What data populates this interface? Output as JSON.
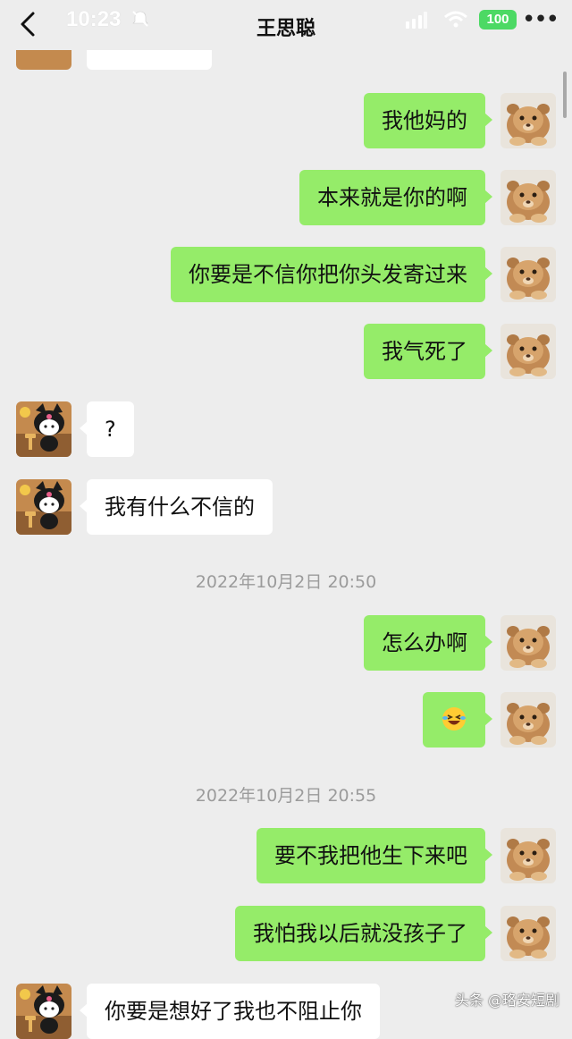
{
  "status": {
    "time": "10:23",
    "battery": "100"
  },
  "header": {
    "title": "王思聪"
  },
  "messages": [
    {
      "side": "me",
      "text": "我他妈的"
    },
    {
      "side": "me",
      "text": "本来就是你的啊"
    },
    {
      "side": "me",
      "text": "你要是不信你把你头发寄过来"
    },
    {
      "side": "me",
      "text": "我气死了"
    },
    {
      "side": "them",
      "text": "?"
    },
    {
      "side": "them",
      "text": "我有什么不信的"
    },
    {
      "timestamp": "2022年10月2日 20:50"
    },
    {
      "side": "me",
      "text": "怎么办啊"
    },
    {
      "side": "me",
      "emoji": "laughing-tears-emoji"
    },
    {
      "timestamp": "2022年10月2日 20:55"
    },
    {
      "side": "me",
      "text": "要不我把他生下来吧"
    },
    {
      "side": "me",
      "text": "我怕我以后就没孩子了"
    },
    {
      "side": "them",
      "text": "你要是想好了我也不阻止你"
    }
  ],
  "watermark": "头条 @珞安短剧",
  "colors": {
    "my_bubble": "#95ec69",
    "their_bubble": "#ffffff",
    "background": "#ededed"
  }
}
